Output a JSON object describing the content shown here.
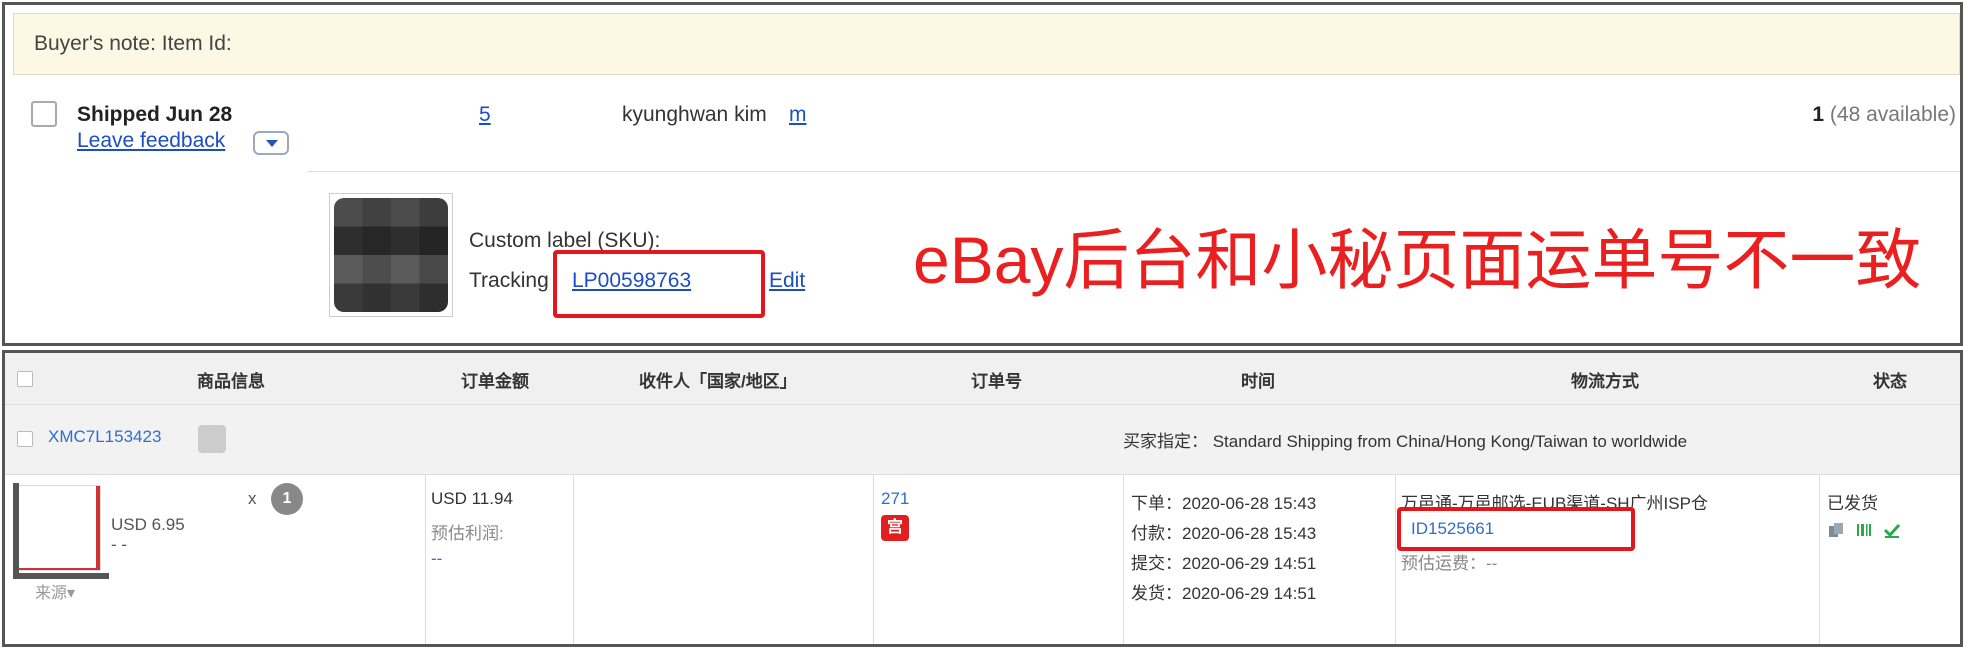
{
  "ebay": {
    "buyer_note": "Buyer's note: Item Id:",
    "shipped": "Shipped Jun 28",
    "leave_feedback": "Leave feedback",
    "qty_link": "5",
    "buyer_name": "kyunghwan kim",
    "buyer_link": "m",
    "qty_count": "1",
    "available": "(48 available)",
    "sku_label": "Custom label (SKU):",
    "tracking_label": "Tracking",
    "tracking_number": "LP00598763",
    "edit": "Edit"
  },
  "annotation": "eBay后台和小秘页面运单号不一致",
  "xiaomi": {
    "headers": {
      "product": "商品信息",
      "amount": "订单金额",
      "recipient": "收件人「国家/地区」",
      "order_no": "订单号",
      "time": "时间",
      "shipping": "物流方式",
      "status": "状态"
    },
    "order_id": "XMC7L153423",
    "buyer_pick": "买家指定： Standard Shipping from China/Hong Kong/Taiwan to worldwide",
    "product": {
      "x": "x",
      "qty": "1",
      "unit_price": "USD 6.95",
      "dash": "- -",
      "source": "来源▾"
    },
    "amount": "USD 11.94",
    "profit_label": "预估利润:",
    "profit_value": "--",
    "order_no": "271",
    "order_badge": "宫",
    "times": [
      "下单：2020-06-28 15:43",
      "付款：2020-06-28 15:43",
      "提交：2020-06-29 14:51",
      "发货：2020-06-29 14:51"
    ],
    "shipping_method": "万邑通-万邑邮选-EUB渠道-SH广州ISP仓",
    "tracking_id": "ID1525661",
    "est_fee": "预估运费：--",
    "status": "已发货"
  },
  "colors": {
    "annotation_red": "#ea1f1f",
    "link_blue": "#1a4dc6",
    "note_bg": "#fcf8e3"
  }
}
